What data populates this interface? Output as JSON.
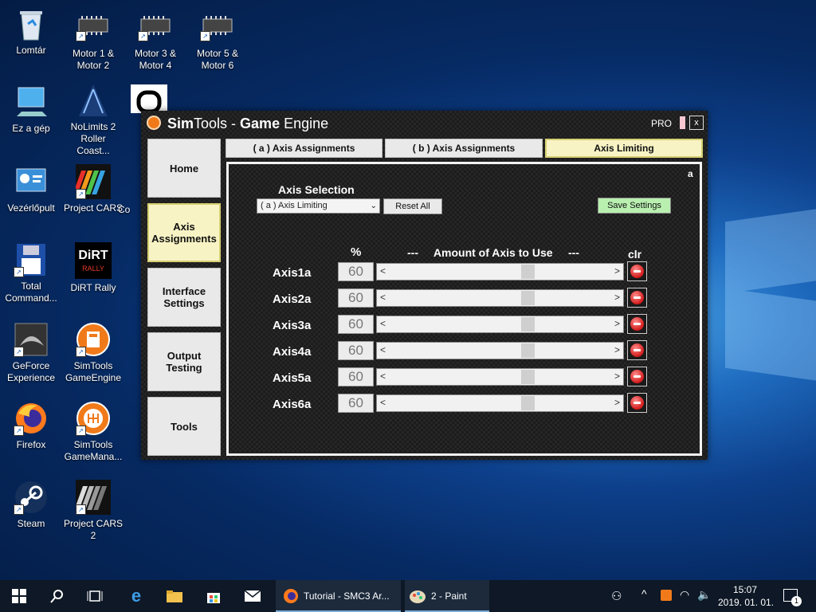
{
  "desktop": {
    "icons": [
      {
        "label": "Lomtár",
        "icon": "recycle-bin-icon"
      },
      {
        "label": "Motor 1 &\nMotor 2",
        "icon": "chip-icon"
      },
      {
        "label": "Motor 3 &\nMotor 4",
        "icon": "chip-icon"
      },
      {
        "label": "Motor 5 &\nMotor 6",
        "icon": "chip-icon"
      },
      {
        "label": "Ez a gép",
        "icon": "computer-icon"
      },
      {
        "label": "NoLimits 2\nRoller Coast...",
        "icon": "nolimits-icon"
      },
      {
        "label": "Vezérlőpult",
        "icon": "control-panel-icon"
      },
      {
        "label": "Project CARS",
        "icon": "project-cars-icon"
      },
      {
        "label": "Co",
        "icon": "app-icon"
      },
      {
        "label": "Total\nCommand...",
        "icon": "floppy-icon"
      },
      {
        "label": "DiRT Rally",
        "icon": "dirt-rally-icon"
      },
      {
        "label": "GeForce\nExperience",
        "icon": "geforce-icon"
      },
      {
        "label": "SimTools\nGameEngine",
        "icon": "simtools-icon"
      },
      {
        "label": "Firefox",
        "icon": "firefox-icon"
      },
      {
        "label": "SimTools\nGameMana...",
        "icon": "gearshift-icon"
      },
      {
        "label": "Steam",
        "icon": "steam-icon"
      },
      {
        "label": "Project CARS\n2",
        "icon": "project-cars-icon"
      }
    ],
    "dirt_logo": "DiRT",
    "dirt_sub": "RALLY"
  },
  "window": {
    "title_bold1": "Sim",
    "title_part1": "Tools - ",
    "title_bold2": "Game",
    "title_part2": " Engine",
    "edition": "PRO",
    "close": "x",
    "corner": "a"
  },
  "sidebar": {
    "items": [
      {
        "label": "Home"
      },
      {
        "label": "Axis Assignments"
      },
      {
        "label": "Interface Settings"
      },
      {
        "label": "Output Testing"
      },
      {
        "label": "Tools"
      }
    ]
  },
  "tabs": [
    {
      "label": "( a ) Axis Assignments"
    },
    {
      "label": "( b ) Axis Assignments"
    },
    {
      "label": "Axis Limiting"
    }
  ],
  "panel": {
    "axis_selection_label": "Axis Selection",
    "axis_selection_value": "( a ) Axis Limiting",
    "reset_all": "Reset All",
    "save_settings": "Save Settings",
    "col_percent": "%",
    "col_amount": "---     Amount of Axis to Use     ---",
    "col_clr": "clr",
    "rows": [
      {
        "name": "Axis1a",
        "value": "60",
        "slider_fraction": 0.6
      },
      {
        "name": "Axis2a",
        "value": "60",
        "slider_fraction": 0.6
      },
      {
        "name": "Axis3a",
        "value": "60",
        "slider_fraction": 0.6
      },
      {
        "name": "Axis4a",
        "value": "60",
        "slider_fraction": 0.6
      },
      {
        "name": "Axis5a",
        "value": "60",
        "slider_fraction": 0.6
      },
      {
        "name": "Axis6a",
        "value": "60",
        "slider_fraction": 0.6
      }
    ],
    "slider_left": "<",
    "slider_right": ">"
  },
  "taskbar": {
    "apps": [
      {
        "label": "Tutorial - SMC3 Ar...",
        "icon": "firefox-icon"
      },
      {
        "label": "2 - Paint",
        "icon": "paint-icon"
      }
    ],
    "time": "15:07",
    "date": "2019. 01. 01.",
    "notifications": "1"
  }
}
